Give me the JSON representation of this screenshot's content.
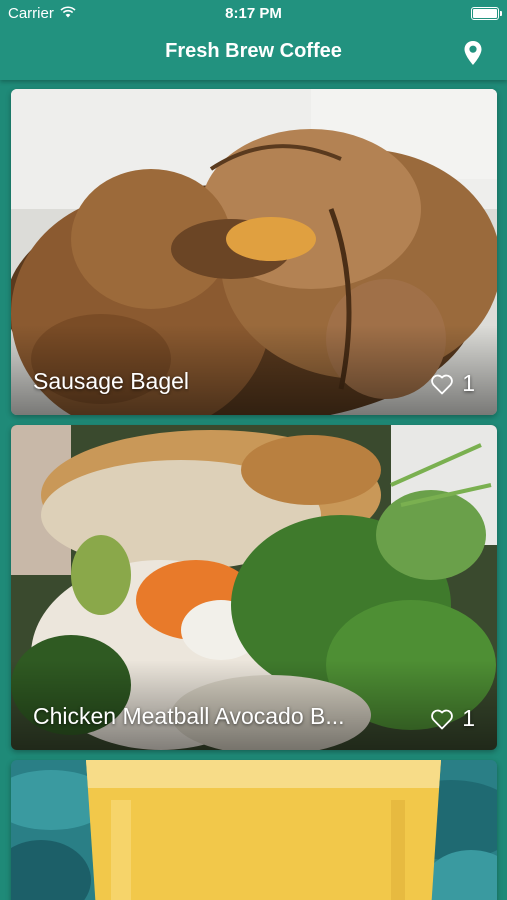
{
  "status_bar": {
    "carrier": "Carrier",
    "time": "8:17 PM",
    "wifi_icon": "wifi-icon",
    "battery_icon": "battery-icon"
  },
  "nav": {
    "title": "Fresh Brew Coffee",
    "location_icon": "map-pin-icon"
  },
  "colors": {
    "header": "#22927f",
    "background": "#1f8a78",
    "text": "#ffffff"
  },
  "feed": {
    "items": [
      {
        "title": "Sausage Bagel",
        "likes": "1",
        "like_icon": "heart-outline-icon",
        "photo": "bagel sandwich"
      },
      {
        "title": "Chicken Meatball Avocado B...",
        "likes": "1",
        "like_icon": "heart-outline-icon",
        "photo": "banh mi sandwich"
      },
      {
        "title": "",
        "likes": "",
        "like_icon": "",
        "photo": "mango smoothie"
      }
    ]
  }
}
